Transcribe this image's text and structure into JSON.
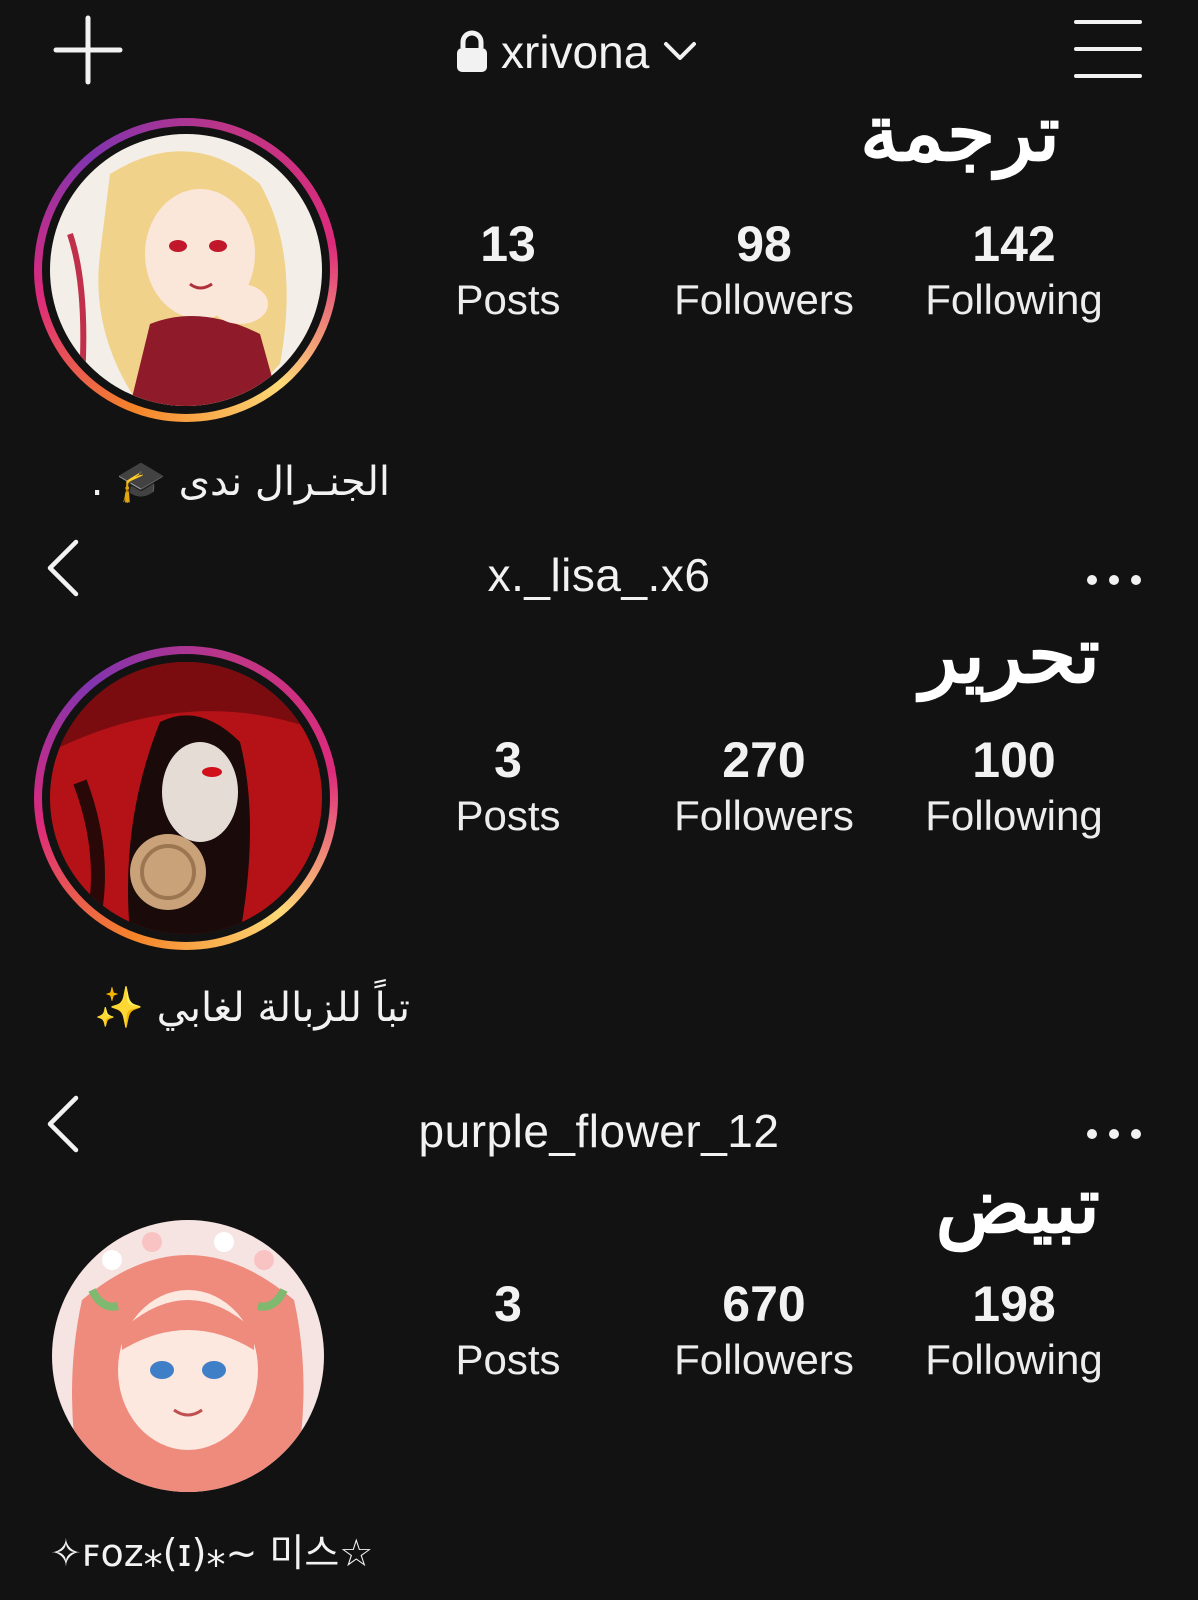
{
  "profiles": [
    {
      "header": {
        "username": "xrivona",
        "lock": true,
        "dropdown": true
      },
      "tag": "ترجمة",
      "stats": {
        "posts": "13",
        "posts_label": "Posts",
        "followers": "98",
        "followers_label": "Followers",
        "following": "142",
        "following_label": "Following"
      },
      "bio": "الجنـرال ندى 🎓 ."
    },
    {
      "header": {
        "username": "x._lisa_.x6"
      },
      "tag": "تحرير",
      "stats": {
        "posts": "3",
        "posts_label": "Posts",
        "followers": "270",
        "followers_label": "Followers",
        "following": "100",
        "following_label": "Following"
      },
      "bio": "تباً للزبالة لغابي ✨"
    },
    {
      "header": {
        "username": "purple_flower_12"
      },
      "tag": "تبيض",
      "stats": {
        "posts": "3",
        "posts_label": "Posts",
        "followers": "670",
        "followers_label": "Followers",
        "following": "198",
        "following_label": "Following"
      },
      "bio": "✧ꜰᴏᴢ⁎(ɪ)⁎~ 미스☆"
    }
  ],
  "icons": {
    "new_post": "plus-icon",
    "menu": "hamburger-menu-icon",
    "back": "back-chevron-icon",
    "more": "more-options-icon"
  },
  "colors": {
    "background": "#121212",
    "text": "#f2f2f2",
    "story_ring_start": "#f58529",
    "story_ring_mid": "#dd2a7b",
    "story_ring_end": "#8134af"
  }
}
